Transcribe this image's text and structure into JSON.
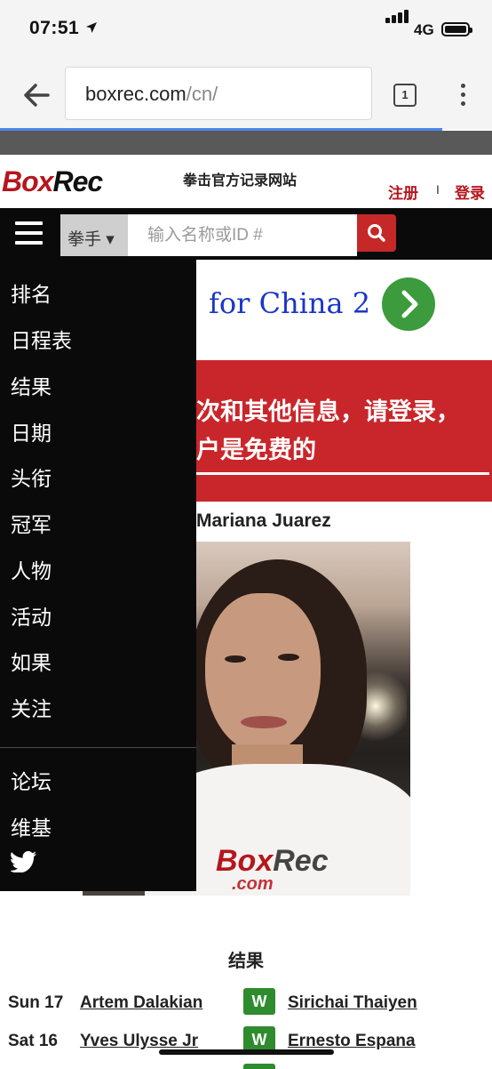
{
  "status_bar": {
    "time": "07:51",
    "network": "4G"
  },
  "browser": {
    "url_host": "boxrec.com",
    "url_path": "/cn/",
    "tab_count": "1"
  },
  "site": {
    "logo_part1": "Box",
    "logo_part2": "Rec",
    "tagline": "拳击官方记录网站",
    "register": "注册",
    "separator": "I",
    "login": "登录"
  },
  "search": {
    "category": "拳手 ▾",
    "placeholder": "输入名称或ID #"
  },
  "promo": {
    "text": "for China 2"
  },
  "notice": {
    "line1": "次和其他信息，请登录，",
    "line2": "户是免费的"
  },
  "featured": {
    "name": "Mariana Juarez",
    "shirt_logo_a": "Box",
    "shirt_logo_b": "Rec",
    "shirt_sub": ".com"
  },
  "menu": {
    "items": [
      "排名",
      "日程表",
      "结果",
      "日期",
      "头衔",
      "冠军",
      "人物",
      "活动",
      "如果",
      "关注"
    ],
    "secondary": [
      "论坛",
      "维基"
    ]
  },
  "results": {
    "heading": "结果",
    "rows": [
      {
        "date": "Sun 17",
        "fighter1": "Artem Dalakian",
        "outcome": "W",
        "fighter2": "Sirichai Thaiyen"
      },
      {
        "date": "Sat 16",
        "fighter1": "Yves Ulysse Jr",
        "outcome": "W",
        "fighter2": "Ernesto Espana"
      }
    ]
  },
  "colors": {
    "brand_red": "#b5161d",
    "win_green": "#2e8b2e",
    "link_blue": "#1a36c7"
  }
}
